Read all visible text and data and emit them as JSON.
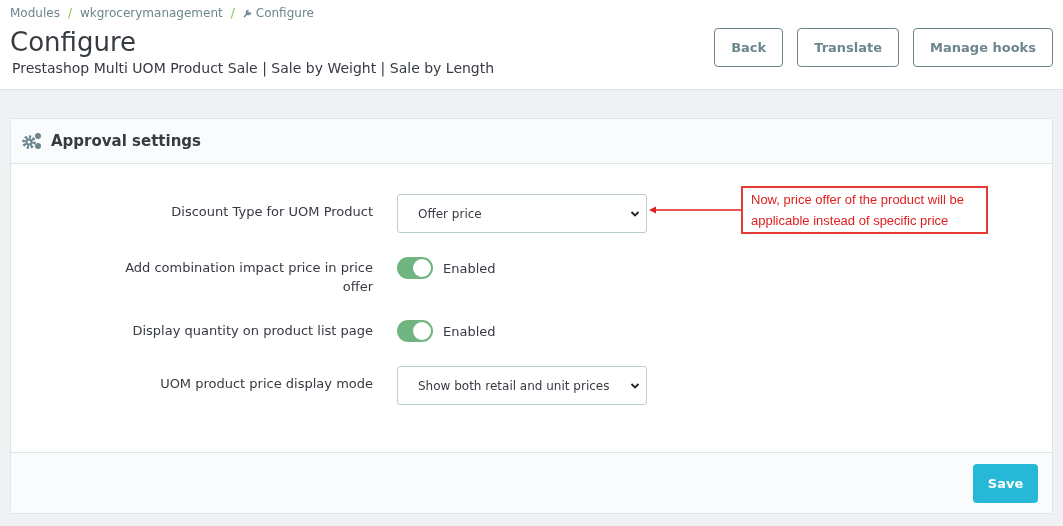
{
  "breadcrumb": [
    "Modules",
    "wkgrocerymanagement",
    "Configure"
  ],
  "breadcrumb_separator": "/",
  "page_title": "Configure",
  "subtitle": "Prestashop Multi UOM Product Sale | Sale by Weight | Sale by Length",
  "toolbar_buttons": [
    "Back",
    "Translate",
    "Manage hooks"
  ],
  "panel": {
    "title": "Approval settings",
    "fields": [
      {
        "kind": "select",
        "label": "Discount Type for UOM Product",
        "value": "Offer price"
      },
      {
        "kind": "switch",
        "label": "Add combination impact price in price offer",
        "on": true,
        "state_label": "Enabled"
      },
      {
        "kind": "switch",
        "label": "Display quantity on product list page",
        "on": true,
        "state_label": "Enabled"
      },
      {
        "kind": "select",
        "label": "UOM product price display mode",
        "value": "Show both retail and unit prices"
      }
    ],
    "callout": "Now, price offer of the product will be applicable instead of specific price",
    "save_button": "Save"
  }
}
